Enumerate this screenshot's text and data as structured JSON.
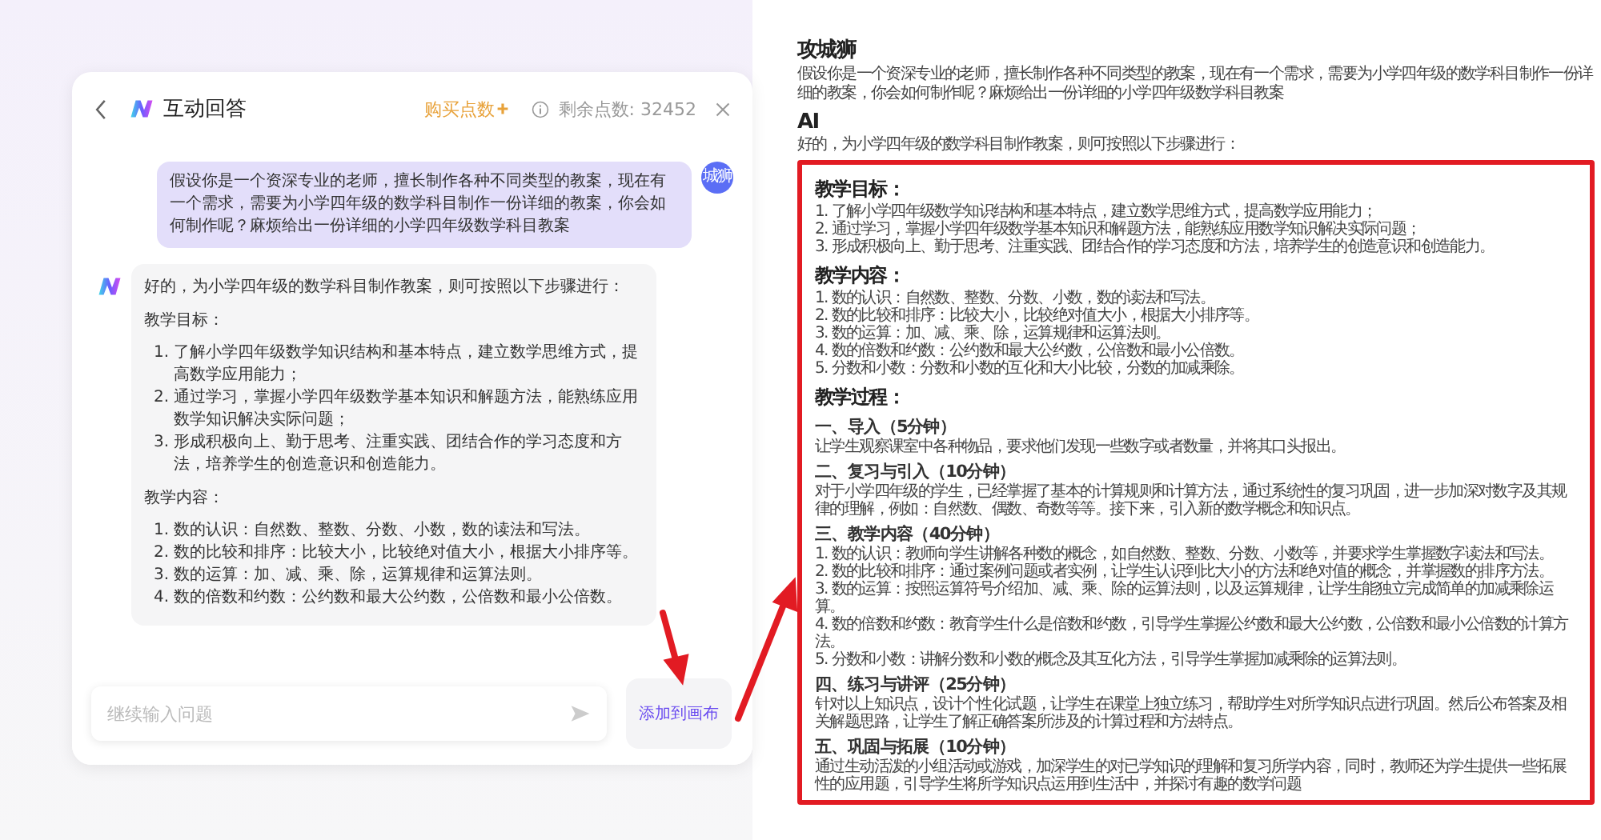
{
  "chat_panel": {
    "title": "互动回答",
    "buy_label": "购买点数",
    "remaining": "剩余点数: 32452",
    "messages": [
      {
        "kind": "user",
        "avatar": "城狮",
        "text": "假设你是一个资深专业的老师，擅长制作各种不同类型的教案，现在有一个需求，需要为小学四年级的数学科目制作一份详细的教案，你会如何制作呢？麻烦给出一份详细的小学四年级数学科目教案"
      },
      {
        "kind": "ai",
        "intro": "好的，为小学四年级的数学科目制作教案，则可按照以下步骤进行：",
        "sections": [
          {
            "heading": "教学目标：",
            "items": [
              {
                "num": "1.",
                "text": "了解小学四年级数学知识结构和基本特点，建立数学思维方式，提高数学应用能力；"
              },
              {
                "num": "2.",
                "text": "通过学习，掌握小学四年级数学基本知识和解题方法，能熟练应用数学知识解决实际问题；"
              },
              {
                "num": "3.",
                "text": "形成积极向上、勤于思考、注重实践、团结合作的学习态度和方法，培养学生的创造意识和创造能力。"
              }
            ]
          },
          {
            "heading": "教学内容：",
            "items": [
              {
                "num": "1.",
                "text": "数的认识：自然数、整数、分数、小数，数的读法和写法。"
              },
              {
                "num": "2.",
                "text": "数的比较和排序：比较大小，比较绝对值大小，根据大小排序等。"
              },
              {
                "num": "3.",
                "text": "数的运算：加、减、乘、除，运算规律和运算法则。"
              },
              {
                "num": "4.",
                "text": "数的倍数和约数：公约数和最大公约数，公倍数和最小公倍数。"
              }
            ]
          }
        ]
      }
    ],
    "input": {
      "placeholder": "继续输入问题"
    },
    "add_button": "添加到画布"
  },
  "canvas": {
    "entries": [
      {
        "author": "攻城狮",
        "text": "假设你是一个资深专业的老师，擅长制作各种不同类型的教案，现在有一个需求，需要为小学四年级的数学科目制作一份详细的教案，你会如何制作呢？麻烦给出一份详细的小学四年级数学科目教案"
      },
      {
        "author": "AI",
        "text": "好的，为小学四年级的数学科目制作教案，则可按照以下步骤进行："
      }
    ],
    "highlighted_blocks": [
      {
        "kind": "h2",
        "text": "教学目标："
      },
      {
        "kind": "p",
        "text": "1. 了解小学四年级数学知识结构和基本特点，建立数学思维方式，提高数学应用能力；"
      },
      {
        "kind": "p",
        "text": "2. 通过学习，掌握小学四年级数学基本知识和解题方法，能熟练应用数学知识解决实际问题；"
      },
      {
        "kind": "p",
        "text": "3. 形成积极向上、勤于思考、注重实践、团结合作的学习态度和方法，培养学生的创造意识和创造能力。"
      },
      {
        "kind": "h2",
        "text": "教学内容："
      },
      {
        "kind": "p",
        "text": "1. 数的认识：自然数、整数、分数、小数，数的读法和写法。"
      },
      {
        "kind": "p",
        "text": "2. 数的比较和排序：比较大小，比较绝对值大小，根据大小排序等。"
      },
      {
        "kind": "p",
        "text": "3. 数的运算：加、减、乘、除，运算规律和运算法则。"
      },
      {
        "kind": "p",
        "text": "4. 数的倍数和约数：公约数和最大公约数，公倍数和最小公倍数。"
      },
      {
        "kind": "p",
        "text": "5. 分数和小数：分数和小数的互化和大小比较，分数的加减乘除。"
      },
      {
        "kind": "h2",
        "text": "教学过程："
      },
      {
        "kind": "h3",
        "text": "一、导入（5分钟）"
      },
      {
        "kind": "p",
        "text": "让学生观察课室中各种物品，要求他们发现一些数字或者数量，并将其口头报出。"
      },
      {
        "kind": "h3",
        "text": "二、复习与引入（10分钟）"
      },
      {
        "kind": "p",
        "text": "对于小学四年级的学生，已经掌握了基本的计算规则和计算方法，通过系统性的复习巩固，进一步加深对数字及其规律的理解，例如：自然数、偶数、奇数等等。接下来，引入新的数学概念和知识点。"
      },
      {
        "kind": "h3",
        "text": "三、教学内容（40分钟）"
      },
      {
        "kind": "p",
        "text": "1. 数的认识：教师向学生讲解各种数的概念，如自然数、整数、分数、小数等，并要求学生掌握数字读法和写法。"
      },
      {
        "kind": "p",
        "text": "2. 数的比较和排序：通过案例问题或者实例，让学生认识到比大小的方法和绝对值的概念，并掌握数的排序方法。"
      },
      {
        "kind": "p",
        "text": "3. 数的运算：按照运算符号介绍加、减、乘、除的运算法则，以及运算规律，让学生能独立完成简单的加减乘除运算。"
      },
      {
        "kind": "p",
        "text": "4. 数的倍数和约数：教育学生什么是倍数和约数，引导学生掌握公约数和最大公约数，公倍数和最小公倍数的计算方法。"
      },
      {
        "kind": "p",
        "text": "5. 分数和小数：讲解分数和小数的概念及其互化方法，引导学生掌握加减乘除的运算法则。"
      },
      {
        "kind": "h3",
        "text": "四、练习与讲评（25分钟）"
      },
      {
        "kind": "p",
        "text": "针对以上知识点，设计个性化试题，让学生在课堂上独立练习，帮助学生对所学知识点进行巩固。然后公布答案及相关解题思路，让学生了解正确答案所涉及的计算过程和方法特点。"
      },
      {
        "kind": "h3",
        "text": "五、巩固与拓展（10分钟）"
      },
      {
        "kind": "p",
        "text": "通过生动活泼的小组活动或游戏，加深学生的对已学知识的理解和复习所学内容，同时，教师还为学生提供一些拓展性的应用题，引导学生将所学知识点运用到生活中，并探讨有趣的数学问题"
      }
    ]
  }
}
